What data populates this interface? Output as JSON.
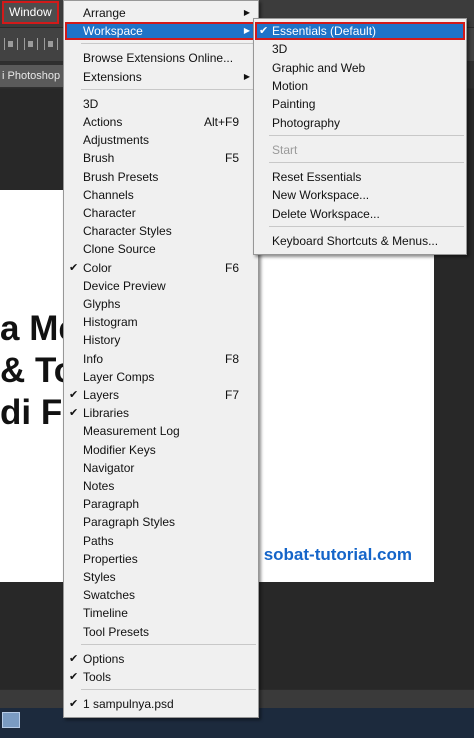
{
  "menubar": {
    "window_label": "Window"
  },
  "document": {
    "tab_label": "i Photoshop",
    "title_lines": [
      "a Me        an",
      "& To       ilang",
      "di F"
    ],
    "watermark": "sobat-tutorial.com"
  },
  "window_menu": {
    "top_items": [
      {
        "label": "Arrange",
        "submenu": true
      },
      {
        "label": "Workspace",
        "submenu": true,
        "highlighted": true
      }
    ],
    "extension_items": [
      {
        "label": "Browse Extensions Online..."
      },
      {
        "label": "Extensions",
        "submenu": true
      }
    ],
    "panel_items": [
      {
        "label": "3D",
        "shortcut": "",
        "checked": false
      },
      {
        "label": "Actions",
        "shortcut": "Alt+F9",
        "checked": false
      },
      {
        "label": "Adjustments",
        "shortcut": "",
        "checked": false
      },
      {
        "label": "Brush",
        "shortcut": "F5",
        "checked": false
      },
      {
        "label": "Brush Presets",
        "shortcut": "",
        "checked": false
      },
      {
        "label": "Channels",
        "shortcut": "",
        "checked": false
      },
      {
        "label": "Character",
        "shortcut": "",
        "checked": false
      },
      {
        "label": "Character Styles",
        "shortcut": "",
        "checked": false
      },
      {
        "label": "Clone Source",
        "shortcut": "",
        "checked": false
      },
      {
        "label": "Color",
        "shortcut": "F6",
        "checked": true
      },
      {
        "label": "Device Preview",
        "shortcut": "",
        "checked": false
      },
      {
        "label": "Glyphs",
        "shortcut": "",
        "checked": false
      },
      {
        "label": "Histogram",
        "shortcut": "",
        "checked": false
      },
      {
        "label": "History",
        "shortcut": "",
        "checked": false
      },
      {
        "label": "Info",
        "shortcut": "F8",
        "checked": false
      },
      {
        "label": "Layer Comps",
        "shortcut": "",
        "checked": false
      },
      {
        "label": "Layers",
        "shortcut": "F7",
        "checked": true
      },
      {
        "label": "Libraries",
        "shortcut": "",
        "checked": true
      },
      {
        "label": "Measurement Log",
        "shortcut": "",
        "checked": false
      },
      {
        "label": "Modifier Keys",
        "shortcut": "",
        "checked": false
      },
      {
        "label": "Navigator",
        "shortcut": "",
        "checked": false
      },
      {
        "label": "Notes",
        "shortcut": "",
        "checked": false
      },
      {
        "label": "Paragraph",
        "shortcut": "",
        "checked": false
      },
      {
        "label": "Paragraph Styles",
        "shortcut": "",
        "checked": false
      },
      {
        "label": "Paths",
        "shortcut": "",
        "checked": false
      },
      {
        "label": "Properties",
        "shortcut": "",
        "checked": false
      },
      {
        "label": "Styles",
        "shortcut": "",
        "checked": false
      },
      {
        "label": "Swatches",
        "shortcut": "",
        "checked": false
      },
      {
        "label": "Timeline",
        "shortcut": "",
        "checked": false
      },
      {
        "label": "Tool Presets",
        "shortcut": "",
        "checked": false
      }
    ],
    "bottom_items": [
      {
        "label": "Options",
        "checked": true
      },
      {
        "label": "Tools",
        "checked": true
      }
    ],
    "document_items": [
      {
        "label": "1 sampulnya.psd",
        "checked": true
      }
    ]
  },
  "workspace_menu": {
    "workspaces": [
      {
        "label": "Essentials (Default)",
        "checked": true,
        "highlighted": true
      },
      {
        "label": "3D"
      },
      {
        "label": "Graphic and Web"
      },
      {
        "label": "Motion"
      },
      {
        "label": "Painting"
      },
      {
        "label": "Photography"
      }
    ],
    "start_item": {
      "label": "Start",
      "disabled": true
    },
    "actions": [
      {
        "label": "Reset Essentials"
      },
      {
        "label": "New Workspace..."
      },
      {
        "label": "Delete Workspace..."
      }
    ],
    "shortcuts_item": {
      "label": "Keyboard Shortcuts & Menus..."
    }
  },
  "glyphs": {
    "check": "✔",
    "arrow": "▶"
  },
  "colors": {
    "highlight": "#1f73c8",
    "annotation_outline": "#d21a1a",
    "watermark": "#1565c9"
  }
}
